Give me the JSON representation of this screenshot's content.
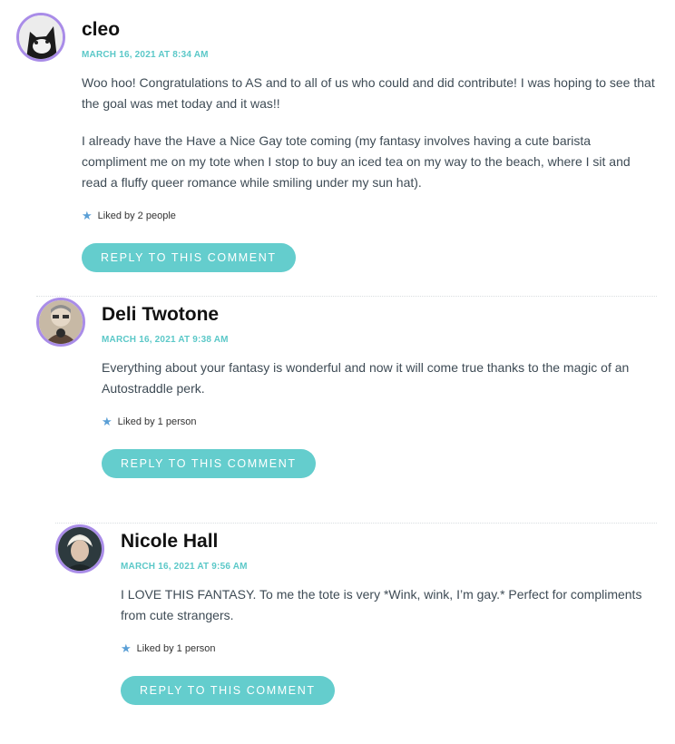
{
  "comments": [
    {
      "author": "cleo",
      "date": "MARCH 16, 2021 AT 8:34 AM",
      "paragraphs": [
        "Woo hoo! Congratulations to AS and to all of us who could and did contribute! I was hoping to see that the goal was met today and it was!!",
        "I already have the Have a Nice Gay tote coming (my fantasy involves having a cute barista compliment me on my tote when I stop to buy an iced tea on my way to the beach, where I sit and read a fluffy queer romance while smiling under my sun hat)."
      ],
      "likes": "Liked by 2 people",
      "reply_label": "REPLY TO THIS COMMENT"
    },
    {
      "author": "Deli Twotone",
      "date": "MARCH 16, 2021 AT 9:38 AM",
      "paragraphs": [
        "Everything about your fantasy is wonderful and now it will come true thanks to the magic of an Autostraddle perk."
      ],
      "likes": "Liked by 1 person",
      "reply_label": "REPLY TO THIS COMMENT"
    },
    {
      "author": "Nicole Hall",
      "date": "MARCH 16, 2021 AT 9:56 AM",
      "paragraphs": [
        "I LOVE THIS FANTASY. To me the tote is very *Wink, wink, I’m gay.* Perfect for compliments from cute strangers."
      ],
      "likes": "Liked by 1 person",
      "reply_label": "REPLY TO THIS COMMENT"
    }
  ],
  "colors": {
    "accent": "#64cdcd",
    "date": "#5bc8c8",
    "avatar_ring": "#a98ce8",
    "star": "#5a9fd6"
  },
  "icons": {
    "like": "star-icon"
  }
}
